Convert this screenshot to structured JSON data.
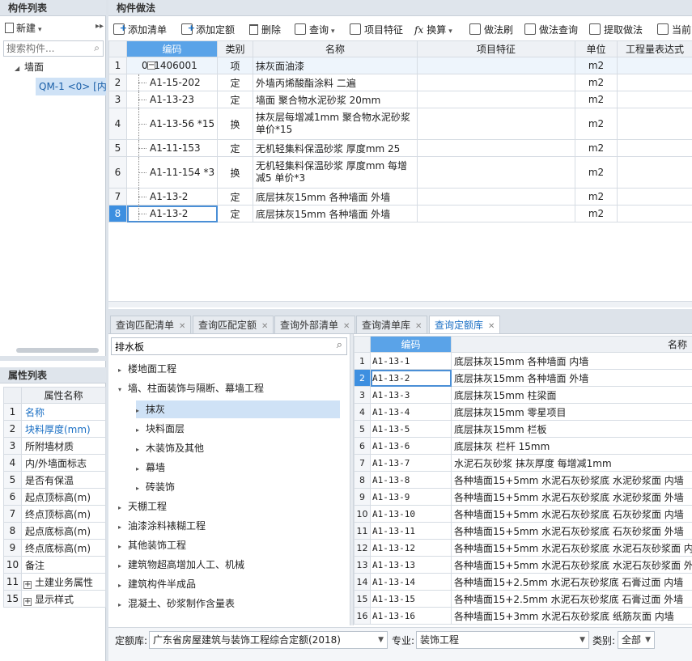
{
  "left_panel": {
    "title": "构件列表",
    "new_label": "新建",
    "search_placeholder": "搜索构件...",
    "tree_root": "墙面",
    "tree_child": "QM-1 <0> [内"
  },
  "props_panel": {
    "title": "属性列表",
    "header": "属性名称",
    "rows": [
      {
        "num": "1",
        "name": "名称"
      },
      {
        "num": "2",
        "name": "块料厚度(mm)"
      },
      {
        "num": "3",
        "name": "所附墙材质"
      },
      {
        "num": "4",
        "name": "内/外墙面标志"
      },
      {
        "num": "5",
        "name": "是否有保温"
      },
      {
        "num": "6",
        "name": "起点顶标高(m)"
      },
      {
        "num": "7",
        "name": "终点顶标高(m)"
      },
      {
        "num": "8",
        "name": "起点底标高(m)"
      },
      {
        "num": "9",
        "name": "终点底标高(m)"
      },
      {
        "num": "10",
        "name": "备注"
      },
      {
        "num": "11",
        "name": "土建业务属性"
      },
      {
        "num": "15",
        "name": "显示样式"
      }
    ]
  },
  "method_panel": {
    "title": "构件做法",
    "toolbar": {
      "add_list": "添加清单",
      "add_quota": "添加定额",
      "delete": "删除",
      "query": "查询",
      "item_feature": "项目特征",
      "convert": "换算",
      "method_brush": "做法刷",
      "method_query": "做法查询",
      "extract": "提取做法",
      "current": "当前"
    },
    "columns": {
      "code": "编码",
      "type": "类别",
      "name": "名称",
      "feature": "项目特征",
      "unit": "单位",
      "expr": "工程量表达式"
    },
    "rows": [
      {
        "num": "1",
        "code": "011406001",
        "type": "项",
        "name": "抹灰面油漆",
        "unit": "m2"
      },
      {
        "num": "2",
        "code": "A1-15-202",
        "type": "定",
        "name": "外墙丙烯酸酯涂料 二遍",
        "unit": "m2"
      },
      {
        "num": "3",
        "code": "A1-13-23",
        "type": "定",
        "name": "墙面 聚合物水泥砂浆 20mm",
        "unit": "m2"
      },
      {
        "num": "4",
        "code": "A1-13-56 *15",
        "type": "换",
        "name": "抹灰层每增减1mm 聚合物水泥砂浆 单价*15",
        "unit": "m2"
      },
      {
        "num": "5",
        "code": "A1-11-153",
        "type": "定",
        "name": "无机轻集料保温砂浆 厚度mm 25",
        "unit": "m2"
      },
      {
        "num": "6",
        "code": "A1-11-154 *3",
        "type": "换",
        "name": "无机轻集料保温砂浆 厚度mm 每增减5 单价*3",
        "unit": "m2"
      },
      {
        "num": "7",
        "code": "A1-13-2",
        "type": "定",
        "name": "底层抹灰15mm 各种墙面 外墙",
        "unit": "m2"
      },
      {
        "num": "8",
        "code": "A1-13-2",
        "type": "定",
        "name": "底层抹灰15mm 各种墙面 外墙",
        "unit": "m2"
      }
    ]
  },
  "tabs": [
    {
      "label": "查询匹配清单"
    },
    {
      "label": "查询匹配定额"
    },
    {
      "label": "查询外部清单"
    },
    {
      "label": "查询清单库"
    },
    {
      "label": "查询定额库"
    }
  ],
  "library": {
    "search_value": "排水板",
    "tree": [
      "楼地面工程",
      "墙、柱面装饰与隔断、幕墙工程",
      "抹灰",
      "块料面层",
      "木装饰及其他",
      "幕墙",
      "砖装饰",
      "天棚工程",
      "油漆涂料裱糊工程",
      "其他装饰工程",
      "建筑物超高增加人工、机械",
      "建筑构件半成品",
      "混凝土、砂浆制作含量表"
    ],
    "columns": {
      "code": "编码",
      "name": "名称"
    },
    "rows": [
      {
        "num": "1",
        "code": "A1-13-1",
        "name": "底层抹灰15mm 各种墙面 内墙"
      },
      {
        "num": "2",
        "code": "A1-13-2",
        "name": "底层抹灰15mm 各种墙面 外墙"
      },
      {
        "num": "3",
        "code": "A1-13-3",
        "name": "底层抹灰15mm 柱梁面"
      },
      {
        "num": "4",
        "code": "A1-13-4",
        "name": "底层抹灰15mm 零星项目"
      },
      {
        "num": "5",
        "code": "A1-13-5",
        "name": "底层抹灰15mm 栏板"
      },
      {
        "num": "6",
        "code": "A1-13-6",
        "name": "底层抹灰 栏杆 15mm"
      },
      {
        "num": "7",
        "code": "A1-13-7",
        "name": "水泥石灰砂浆 抹灰厚度 每增减1mm"
      },
      {
        "num": "8",
        "code": "A1-13-8",
        "name": "各种墙面15+5mm 水泥石灰砂浆底 水泥砂浆面 内墙"
      },
      {
        "num": "9",
        "code": "A1-13-9",
        "name": "各种墙面15+5mm 水泥石灰砂浆底 水泥砂浆面 外墙"
      },
      {
        "num": "10",
        "code": "A1-13-10",
        "name": "各种墙面15+5mm 水泥石灰砂浆底 石灰砂浆面 内墙"
      },
      {
        "num": "11",
        "code": "A1-13-11",
        "name": "各种墙面15+5mm 水泥石灰砂浆底 石灰砂浆面 外墙"
      },
      {
        "num": "12",
        "code": "A1-13-12",
        "name": "各种墙面15+5mm 水泥石灰砂浆底 水泥石灰砂浆面 内墙"
      },
      {
        "num": "13",
        "code": "A1-13-13",
        "name": "各种墙面15+5mm 水泥石灰砂浆底 水泥石灰砂浆面 外墙"
      },
      {
        "num": "14",
        "code": "A1-13-14",
        "name": "各种墙面15+2.5mm 水泥石灰砂浆底 石膏过面 内墙"
      },
      {
        "num": "15",
        "code": "A1-13-15",
        "name": "各种墙面15+2.5mm 水泥石灰砂浆底 石膏过面 外墙"
      },
      {
        "num": "16",
        "code": "A1-13-16",
        "name": "各种墙面15+3mm 水泥石灰砂浆底 纸筋灰面 内墙"
      }
    ],
    "footer": {
      "quota_label": "定额库:",
      "quota_value": "广东省房屋建筑与装饰工程综合定额(2018)",
      "major_label": "专业:",
      "major_value": "装饰工程",
      "category_label": "类别:",
      "category_value": "全部"
    }
  },
  "colors": {
    "accent": "#3d8fe0",
    "selected_row": "#dbe9f8"
  }
}
